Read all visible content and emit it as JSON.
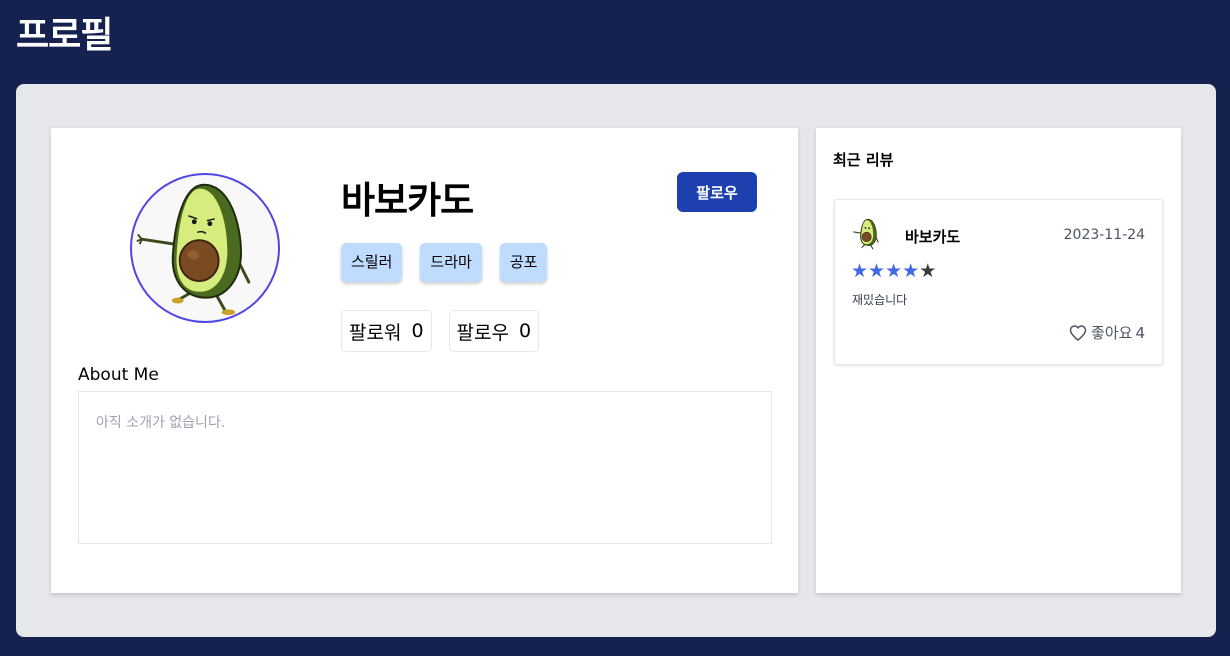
{
  "header": {
    "title": "프로필"
  },
  "profile": {
    "username": "바보카도",
    "follow_label": "팔로우",
    "genres": [
      "스릴러",
      "드라마",
      "공포"
    ],
    "stats": [
      {
        "label": "팔로워",
        "value": "0"
      },
      {
        "label": "팔로우",
        "value": "0"
      }
    ],
    "about_label": "About Me",
    "about_text": "아직 소개가 없습니다."
  },
  "reviews": {
    "title": "최근 리뷰",
    "items": [
      {
        "author": "바보카도",
        "date": "2023-11-24",
        "rating": 4,
        "rating_max": 5,
        "text": "재밌습니다",
        "like_label": "좋아요",
        "like_count": "4"
      }
    ]
  },
  "colors": {
    "background": "#15214f",
    "panel": "#e5e7eb",
    "primary_button": "#1e40af",
    "genre_tag": "#bfdbfe",
    "avatar_border": "#4f46e5",
    "star_filled": "#4169e1"
  },
  "icons": {
    "avatar": "avocado-character-icon",
    "like": "heart-icon",
    "rating": "star-icon"
  }
}
